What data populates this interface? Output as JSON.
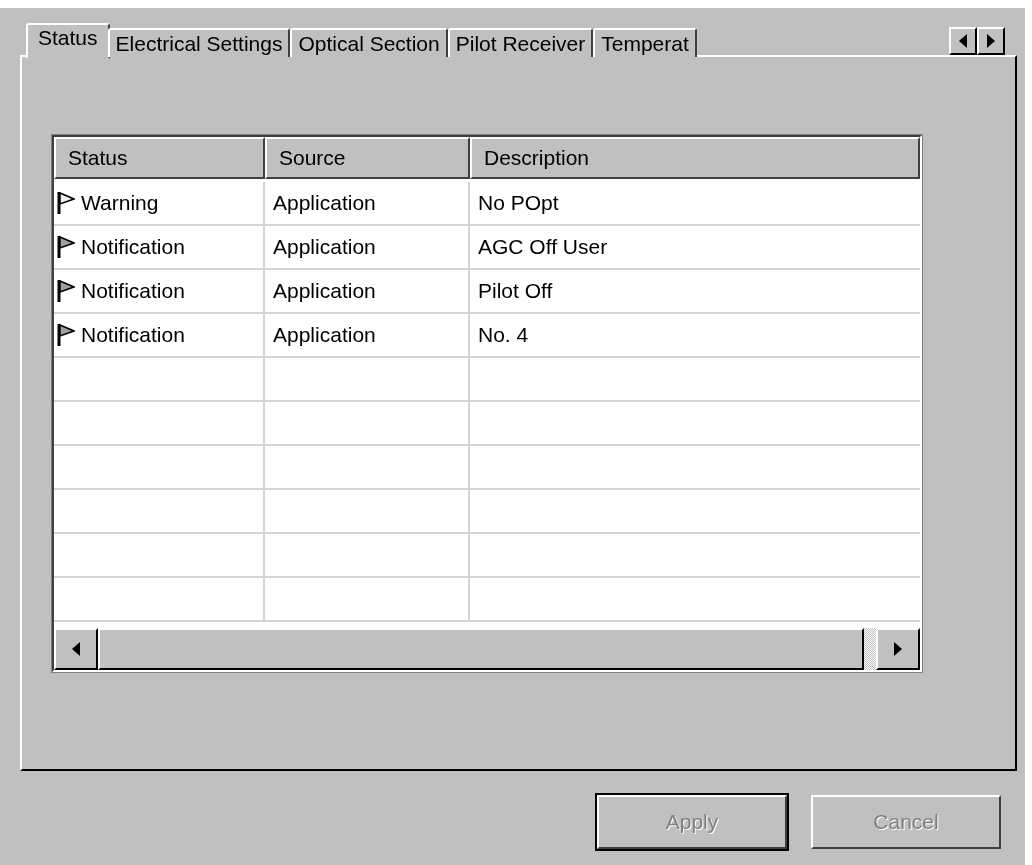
{
  "tabs": [
    {
      "label": "Status",
      "selected": true
    },
    {
      "label": "Electrical Settings",
      "selected": false
    },
    {
      "label": "Optical Section",
      "selected": false
    },
    {
      "label": "Pilot Receiver",
      "selected": false
    },
    {
      "label": "Temperat",
      "selected": false
    }
  ],
  "table": {
    "columns": [
      "Status",
      "Source",
      "Description"
    ],
    "rows": [
      {
        "kind": "warning",
        "status": "Warning",
        "source": "Application",
        "description": "No POpt"
      },
      {
        "kind": "notification",
        "status": "Notification",
        "source": "Application",
        "description": "AGC Off User"
      },
      {
        "kind": "notification",
        "status": "Notification",
        "source": "Application",
        "description": "Pilot Off"
      },
      {
        "kind": "notification",
        "status": "Notification",
        "source": "Application",
        "description": "No. 4"
      }
    ]
  },
  "buttons": [
    {
      "label": "Apply",
      "disabled": true
    },
    {
      "label": "Cancel",
      "disabled": true
    }
  ]
}
